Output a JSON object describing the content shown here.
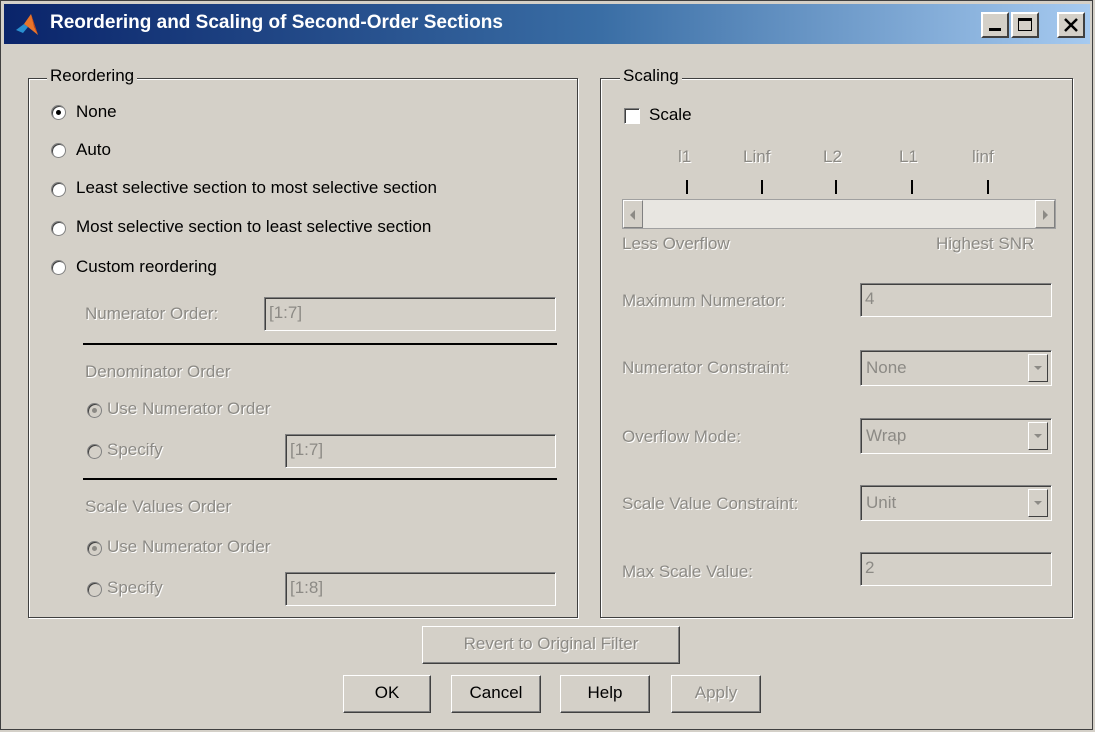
{
  "window": {
    "title": "Reordering and Scaling of Second-Order Sections"
  },
  "title_buttons": {
    "minimize": "_",
    "maximize": "□",
    "close": "X"
  },
  "reordering": {
    "group_label": "Reordering",
    "options": [
      {
        "label": "None",
        "selected": true
      },
      {
        "label": "Auto",
        "selected": false
      },
      {
        "label": "Least selective section to most selective section",
        "selected": false
      },
      {
        "label": "Most selective section to least selective section",
        "selected": false
      },
      {
        "label": "Custom reordering",
        "selected": false
      }
    ],
    "numerator_order_label": "Numerator Order:",
    "numerator_order_value": "[1:7]",
    "denominator_heading": "Denominator Order",
    "denominator_use_numerator": "Use Numerator Order",
    "denominator_specify": "Specify",
    "denominator_value": "[1:7]",
    "scale_values_heading": "Scale Values Order",
    "scale_use_numerator": "Use Numerator Order",
    "scale_specify": "Specify",
    "scale_value": "[1:8]"
  },
  "scaling": {
    "group_label": "Scaling",
    "scale_checkbox_label": "Scale",
    "scale_checked": false,
    "slider_ticks": [
      "l1",
      "Linf",
      "L2",
      "L1",
      "linf"
    ],
    "slider_left_label": "Less Overflow",
    "slider_right_label": "Highest SNR",
    "max_numerator_label": "Maximum Numerator:",
    "max_numerator_value": "4",
    "numerator_constraint_label": "Numerator Constraint:",
    "numerator_constraint_value": "None",
    "overflow_mode_label": "Overflow Mode:",
    "overflow_mode_value": "Wrap",
    "scale_value_constraint_label": "Scale Value Constraint:",
    "scale_value_constraint_value": "Unit",
    "max_scale_value_label": "Max Scale Value:",
    "max_scale_value_value": "2"
  },
  "buttons": {
    "revert": "Revert to Original Filter",
    "ok": "OK",
    "cancel": "Cancel",
    "help": "Help",
    "apply": "Apply"
  }
}
